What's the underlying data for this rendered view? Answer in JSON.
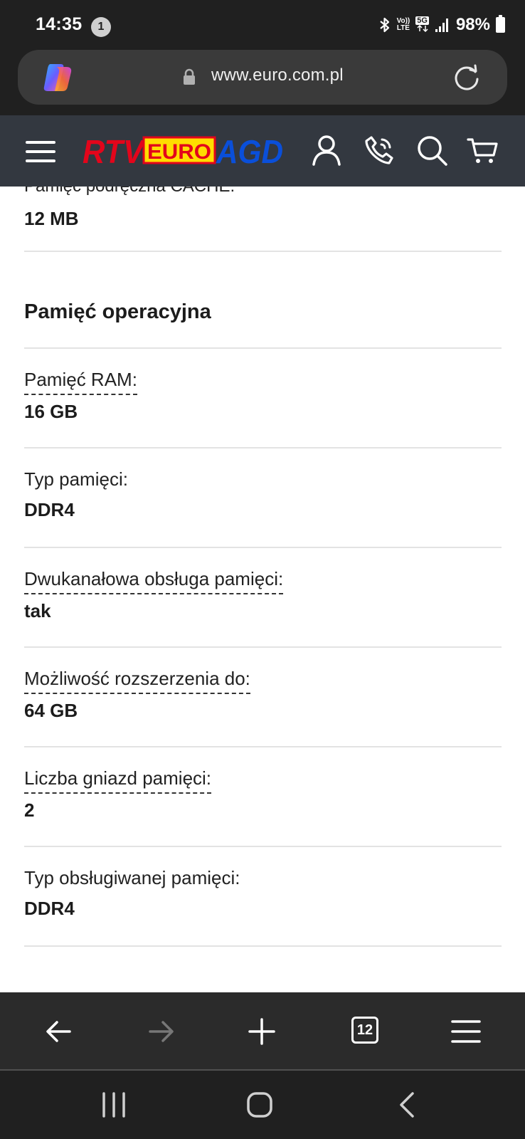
{
  "status_bar": {
    "time": "14:35",
    "notification_count": "1",
    "volte_top": "Vo))",
    "volte_bottom": "LTE",
    "network": "5G",
    "battery": "98%"
  },
  "browser": {
    "url": "www.euro.com.pl",
    "tab_count": "12"
  },
  "site_header": {
    "logo_parts": [
      "RTV",
      "EURO",
      "AGD"
    ],
    "brand_colors": {
      "red": "#e3051b",
      "yellow": "#ffdd00",
      "blue": "#0a4fd9"
    }
  },
  "specs": {
    "cut_label": "Pamięć podręczna CACHE:",
    "cache_value": "12 MB",
    "section_title": "Pamięć operacyjna",
    "rows": [
      {
        "label": "Pamięć RAM:",
        "value": "16 GB"
      },
      {
        "label": "Typ pamięci:",
        "value": "DDR4"
      },
      {
        "label": "Dwukanałowa obsługa pamięci:",
        "value": "tak"
      },
      {
        "label": "Możliwość rozszerzenia do:",
        "value": "64 GB"
      },
      {
        "label": "Liczba gniazd pamięci:",
        "value": "2"
      },
      {
        "label": "Typ obsługiwanej pamięci:",
        "value": "DDR4"
      }
    ]
  },
  "colors": {
    "header_bg": "#333840",
    "chrome_bg": "#202020",
    "divider": "#e3e3e3"
  }
}
